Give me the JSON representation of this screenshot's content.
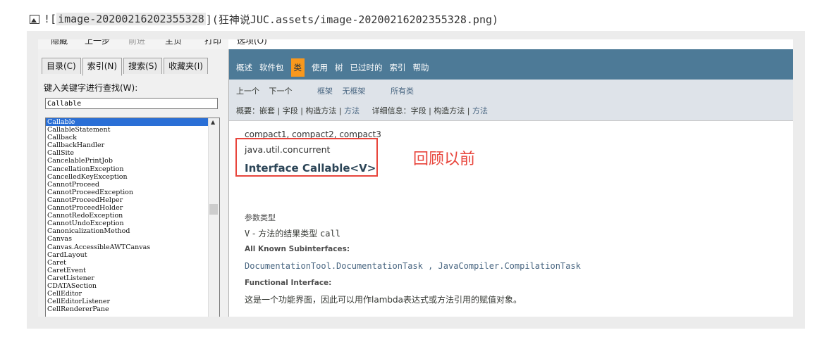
{
  "markdown": {
    "prefix": "![",
    "alt": "image-20200216202355328",
    "suffix": "](狂神说JUC.assets/image-20200216202355328.png)"
  },
  "toolbar": {
    "items": [
      "隐藏",
      "上一步",
      "前进",
      "主页",
      "打印"
    ],
    "options_menu": "选项(O)"
  },
  "left_panel": {
    "tabs": [
      "目录(C)",
      "索引(N)",
      "搜索(S)",
      "收藏夹(I)"
    ],
    "active_tab": 1,
    "find_label": "键入关键字进行查找(W):",
    "search_value": "Callable",
    "list": [
      "Callable",
      "CallableStatement",
      "Callback",
      "CallbackHandler",
      "CallSite",
      "CancelablePrintJob",
      "CancellationException",
      "CancelledKeyException",
      "CannotProceed",
      "CannotProceedException",
      "CannotProceedHelper",
      "CannotProceedHolder",
      "CannotRedoException",
      "CannotUndoException",
      "CanonicalizationMethod",
      "Canvas",
      "Canvas.AccessibleAWTCanvas",
      "CardLayout",
      "Caret",
      "CaretEvent",
      "CaretListener",
      "CDATASection",
      "CellEditor",
      "CellEditorListener",
      "CellRendererPane"
    ],
    "selected_index": 0
  },
  "nav": {
    "items": [
      "概述",
      "软件包",
      "类",
      "使用",
      "树",
      "已过时的",
      "索引",
      "帮助"
    ],
    "active_index": 2
  },
  "subnav": {
    "prev": "上一个",
    "next": "下一个",
    "frames": "框架",
    "no_frames": "无框架",
    "all_classes": "所有类",
    "summary_label": "概要：",
    "summary_nested": "嵌套",
    "summary_field": "字段",
    "summary_constr": "构造方法",
    "summary_method": "方法",
    "detail_label": "详细信息：",
    "detail_field": "字段",
    "detail_constr": "构造方法",
    "detail_method": "方法"
  },
  "content": {
    "above_text": "compact1, compact2, compact3",
    "package": "java.util.concurrent",
    "title": "Interface Callable<V>",
    "type_params_heading": "参数类型",
    "type_param_code": "V",
    "type_param_desc": " - 方法的结果类型 ",
    "type_param_call": "call",
    "subinterfaces_heading": "All Known Subinterfaces:",
    "subinterfaces": "DocumentationTool.DocumentationTask , JavaCompiler.CompilationTask",
    "functional_heading": "Functional Interface:",
    "functional_text": "这是一个功能界面，因此可以用作lambda表达式或方法引用的赋值对象。"
  },
  "annotation": {
    "text": "回顾以前",
    "color": "#e8453c"
  },
  "colors": {
    "nav_bg": "#4d7a97",
    "nav_active": "#f8981d",
    "subnav_bg": "#dee3e9",
    "list_selected": "#2a6fd6"
  }
}
